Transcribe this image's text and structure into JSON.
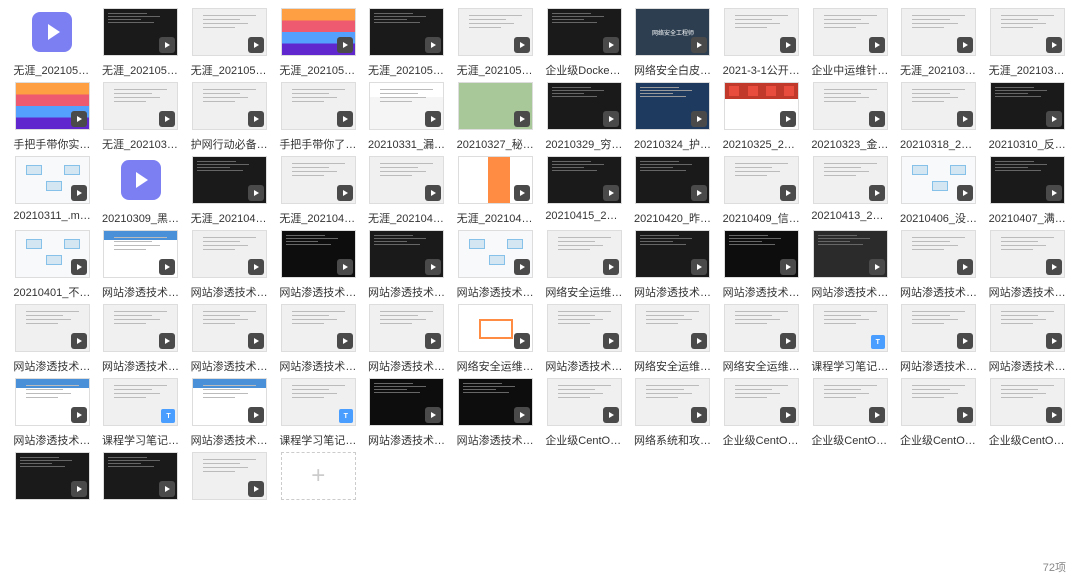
{
  "status": {
    "count": "72项"
  },
  "items": [
    {
      "label": "无涯_20210520_...",
      "thumb": "vidicon",
      "badge": "play"
    },
    {
      "label": "无涯_20210521_...",
      "thumb": "dark",
      "badge": "play"
    },
    {
      "label": "无涯_20210522_...",
      "thumb": "gray",
      "badge": "play"
    },
    {
      "label": "无涯_20210527_...",
      "thumb": "colorbar",
      "badge": "play"
    },
    {
      "label": "无涯_20210528_...",
      "thumb": "dark",
      "badge": "play"
    },
    {
      "label": "无涯_20210529_...",
      "thumb": "gray",
      "badge": "play"
    },
    {
      "label": "企业级Docker容...",
      "thumb": "dark",
      "badge": "play"
    },
    {
      "label": "网络安全白皮书V...",
      "thumb": "navy",
      "badge": "play",
      "navytext": "网络安全工程师"
    },
    {
      "label": "2021-3-1公开课...",
      "thumb": "gray",
      "badge": "play"
    },
    {
      "label": "企业中运维针对...",
      "thumb": "gray",
      "badge": "play"
    },
    {
      "label": "无涯_20210328_...",
      "thumb": "gray",
      "badge": "play"
    },
    {
      "label": "无涯_20210330_...",
      "thumb": "gray",
      "badge": "play"
    },
    {
      "label": "手把手带你实现...",
      "thumb": "colorbar",
      "badge": "play"
    },
    {
      "label": "无涯_20210326_...",
      "thumb": "gray",
      "badge": "play"
    },
    {
      "label": "护网行动必备技...",
      "thumb": "gray",
      "badge": "play"
    },
    {
      "label": "手把手带你了解...",
      "thumb": "gray",
      "badge": "play"
    },
    {
      "label": "20210331_漏克...",
      "thumb": "mixed",
      "badge": "play"
    },
    {
      "label": "20210327_秘钥...",
      "thumb": "map",
      "badge": "play"
    },
    {
      "label": "20210329_穷端...",
      "thumb": "dark",
      "badge": "play"
    },
    {
      "label": "20210324_护网...",
      "thumb": "darkblue",
      "badge": "play"
    },
    {
      "label": "20210325_21世...",
      "thumb": "red",
      "badge": "play"
    },
    {
      "label": "20210323_金三...",
      "thumb": "gray",
      "badge": "play"
    },
    {
      "label": "20210318_21世...",
      "thumb": "gray",
      "badge": "play"
    },
    {
      "label": "20210310_反黑...",
      "thumb": "dark",
      "badge": "play"
    },
    {
      "label": "20210311_.mp4",
      "thumb": "flow",
      "badge": "play"
    },
    {
      "label": "20210309_黑客...",
      "thumb": "vidicon",
      "badge": "play"
    },
    {
      "label": "无涯_20210424_...",
      "thumb": "dark",
      "badge": "play"
    },
    {
      "label": "无涯_20210423_...",
      "thumb": "gray",
      "badge": "play"
    },
    {
      "label": "无涯_20210423,...",
      "thumb": "gray",
      "badge": "play"
    },
    {
      "label": "无涯_20210402_...",
      "thumb": "banner",
      "badge": "play"
    },
    {
      "label": "20210415_2003...",
      "thumb": "dark",
      "badge": "play"
    },
    {
      "label": "20210420_昨晚...",
      "thumb": "dark",
      "badge": "play"
    },
    {
      "label": "20210409_信不...",
      "thumb": "gray",
      "badge": "play"
    },
    {
      "label": "20210413_2005...",
      "thumb": "gray",
      "badge": "play"
    },
    {
      "label": "20210406_没注...",
      "thumb": "flow",
      "badge": "play"
    },
    {
      "label": "20210407_满足...",
      "thumb": "dark",
      "badge": "play"
    },
    {
      "label": "20210401_不会...",
      "thumb": "flow",
      "badge": "play"
    },
    {
      "label": "网站渗透技术-03...",
      "thumb": "bluebar",
      "badge": "play"
    },
    {
      "label": "网站渗透技术-05...",
      "thumb": "gray",
      "badge": "play"
    },
    {
      "label": "网站渗透技术-04...",
      "thumb": "code",
      "badge": "play"
    },
    {
      "label": "网站渗透技术-01...",
      "thumb": "dark",
      "badge": "play"
    },
    {
      "label": "网站渗透技术-06...",
      "thumb": "flow",
      "badge": "play"
    },
    {
      "label": "网络安全运维班...",
      "thumb": "gray",
      "badge": "play"
    },
    {
      "label": "网站渗透技术-04...",
      "thumb": "dark",
      "badge": "play"
    },
    {
      "label": "网站渗透技术-02...",
      "thumb": "code",
      "badge": "play"
    },
    {
      "label": "网站渗透技术-02...",
      "thumb": "term",
      "badge": "play"
    },
    {
      "label": "网站渗透技术-07...",
      "thumb": "gray",
      "badge": "play"
    },
    {
      "label": "网站渗透技术-03...",
      "thumb": "gray",
      "badge": "play"
    },
    {
      "label": "网站渗透技术-02...",
      "thumb": "gray",
      "badge": "play"
    },
    {
      "label": "网站渗透技术-10...",
      "thumb": "gray",
      "badge": "play"
    },
    {
      "label": "网站渗透技术-08...",
      "thumb": "gray",
      "badge": "play"
    },
    {
      "label": "网站渗透技术-09...",
      "thumb": "gray",
      "badge": "play"
    },
    {
      "label": "网站渗透技术-06...",
      "thumb": "gray",
      "badge": "play"
    },
    {
      "label": "网络安全运维班...",
      "thumb": "orangebox",
      "badge": "play"
    },
    {
      "label": "网站渗透技术-05...",
      "thumb": "gray",
      "badge": "play"
    },
    {
      "label": "网络安全运维班...",
      "thumb": "gray",
      "badge": "play"
    },
    {
      "label": "网络安全运维班...",
      "thumb": "gray",
      "badge": "play"
    },
    {
      "label": "课程学习笔记.txt",
      "thumb": "gray",
      "badge": "txt"
    },
    {
      "label": "网站渗透技术-01...",
      "thumb": "gray",
      "badge": "play"
    },
    {
      "label": "网站渗透技术-04...",
      "thumb": "gray",
      "badge": "play"
    },
    {
      "label": "网站渗透技术-03...",
      "thumb": "bluebar",
      "badge": "play"
    },
    {
      "label": "课程学习笔记-02...",
      "thumb": "gray",
      "badge": "txt"
    },
    {
      "label": "网站渗透技术-02...",
      "thumb": "bluebar",
      "badge": "play"
    },
    {
      "label": "课程学习笔记-01...",
      "thumb": "gray",
      "badge": "txt"
    },
    {
      "label": "网站渗透技术-02...",
      "thumb": "code",
      "badge": "play"
    },
    {
      "label": "网站渗透技术-02...",
      "thumb": "code",
      "badge": "play"
    },
    {
      "label": "企业级CentOS系...",
      "thumb": "gray",
      "badge": "play"
    },
    {
      "label": "网络系统和攻防...",
      "thumb": "gray",
      "badge": "play"
    },
    {
      "label": "企业级CentOS系...",
      "thumb": "gray",
      "badge": "play"
    },
    {
      "label": "企业级CentOS系...",
      "thumb": "gray",
      "badge": "play"
    },
    {
      "label": "企业级CentOS系...",
      "thumb": "gray",
      "badge": "play"
    },
    {
      "label": "企业级CentOS系...",
      "thumb": "gray",
      "badge": "play"
    },
    {
      "label": "",
      "thumb": "dark",
      "badge": "play"
    },
    {
      "label": "",
      "thumb": "dark",
      "badge": "play"
    },
    {
      "label": "",
      "thumb": "gray",
      "badge": "play"
    },
    {
      "label": "",
      "thumb": "empty",
      "badge": "none"
    }
  ]
}
